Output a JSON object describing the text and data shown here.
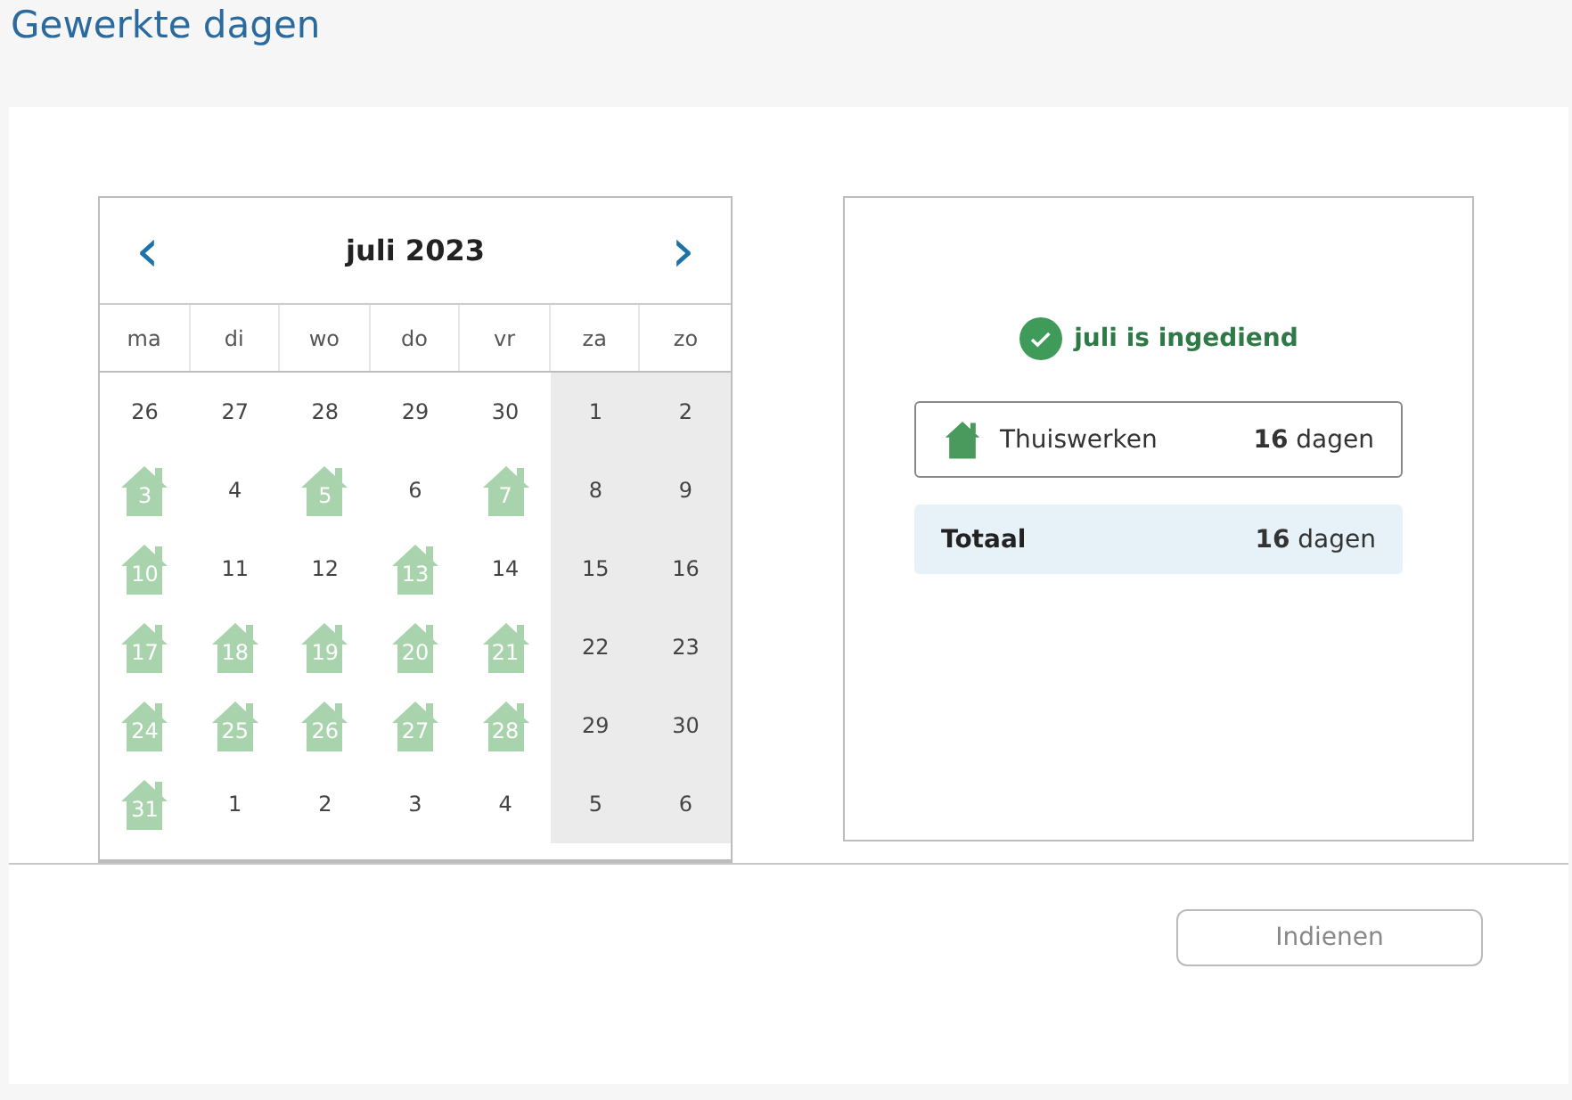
{
  "page_title": "Gewerkte dagen",
  "calendar": {
    "title": "juli 2023",
    "prev": "‹",
    "next": "›",
    "weekdays": [
      "ma",
      "di",
      "wo",
      "do",
      "vr",
      "za",
      "zo"
    ],
    "days": [
      {
        "day": "26",
        "kind": "plain",
        "weekend": false
      },
      {
        "day": "27",
        "kind": "plain",
        "weekend": false
      },
      {
        "day": "28",
        "kind": "plain",
        "weekend": false
      },
      {
        "day": "29",
        "kind": "plain",
        "weekend": false
      },
      {
        "day": "30",
        "kind": "plain",
        "weekend": false
      },
      {
        "day": "1",
        "kind": "plain",
        "weekend": true
      },
      {
        "day": "2",
        "kind": "plain",
        "weekend": true
      },
      {
        "day": "3",
        "kind": "home",
        "weekend": false
      },
      {
        "day": "4",
        "kind": "plain",
        "weekend": false
      },
      {
        "day": "5",
        "kind": "home",
        "weekend": false
      },
      {
        "day": "6",
        "kind": "plain",
        "weekend": false
      },
      {
        "day": "7",
        "kind": "home",
        "weekend": false
      },
      {
        "day": "8",
        "kind": "plain",
        "weekend": true
      },
      {
        "day": "9",
        "kind": "plain",
        "weekend": true
      },
      {
        "day": "10",
        "kind": "home",
        "weekend": false
      },
      {
        "day": "11",
        "kind": "plain",
        "weekend": false
      },
      {
        "day": "12",
        "kind": "plain",
        "weekend": false
      },
      {
        "day": "13",
        "kind": "home",
        "weekend": false
      },
      {
        "day": "14",
        "kind": "plain",
        "weekend": false
      },
      {
        "day": "15",
        "kind": "plain",
        "weekend": true
      },
      {
        "day": "16",
        "kind": "plain",
        "weekend": true
      },
      {
        "day": "17",
        "kind": "home",
        "weekend": false
      },
      {
        "day": "18",
        "kind": "home",
        "weekend": false
      },
      {
        "day": "19",
        "kind": "home",
        "weekend": false
      },
      {
        "day": "20",
        "kind": "home",
        "weekend": false
      },
      {
        "day": "21",
        "kind": "home",
        "weekend": false
      },
      {
        "day": "22",
        "kind": "plain",
        "weekend": true
      },
      {
        "day": "23",
        "kind": "plain",
        "weekend": true
      },
      {
        "day": "24",
        "kind": "home",
        "weekend": false
      },
      {
        "day": "25",
        "kind": "home",
        "weekend": false
      },
      {
        "day": "26",
        "kind": "home",
        "weekend": false
      },
      {
        "day": "27",
        "kind": "home",
        "weekend": false
      },
      {
        "day": "28",
        "kind": "home",
        "weekend": false
      },
      {
        "day": "29",
        "kind": "plain",
        "weekend": true
      },
      {
        "day": "30",
        "kind": "plain",
        "weekend": true
      },
      {
        "day": "31",
        "kind": "home",
        "weekend": false
      },
      {
        "day": "1",
        "kind": "plain",
        "weekend": false
      },
      {
        "day": "2",
        "kind": "plain",
        "weekend": false
      },
      {
        "day": "3",
        "kind": "plain",
        "weekend": false
      },
      {
        "day": "4",
        "kind": "plain",
        "weekend": false
      },
      {
        "day": "5",
        "kind": "plain",
        "weekend": true
      },
      {
        "day": "6",
        "kind": "plain",
        "weekend": true
      }
    ]
  },
  "summary": {
    "status": "juli is ingediend",
    "rows": [
      {
        "kind": "category",
        "label": "Thuiswerken",
        "count": "**16** dagen"
      },
      {
        "kind": "total",
        "label": "Totaal",
        "count": "**16** dagen"
      }
    ]
  },
  "submit_button": {
    "label": "Indienen",
    "disabled": true
  }
}
